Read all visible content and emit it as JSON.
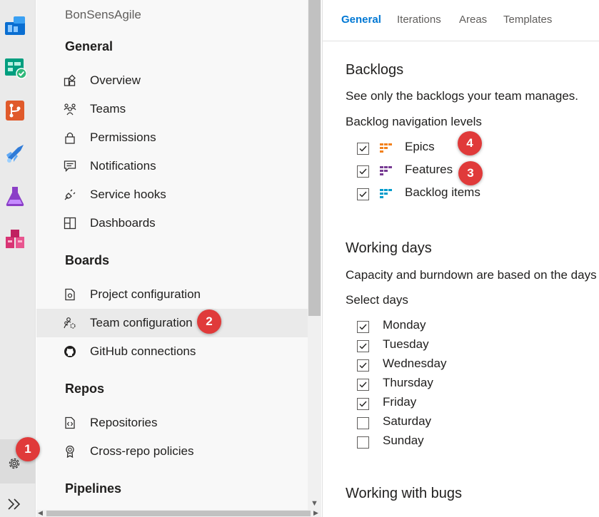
{
  "rail": {
    "icons": [
      "boards-overview-icon",
      "boards-icon",
      "repos-icon",
      "pipelines-icon",
      "test-plans-icon",
      "artifacts-icon"
    ],
    "settings_icon": "gear-icon",
    "expand_icon": "double-chevron-right-icon"
  },
  "nav": {
    "project_name": "BonSensAgile",
    "sections": {
      "general": "General",
      "boards": "Boards",
      "repos": "Repos",
      "pipelines": "Pipelines"
    },
    "items": {
      "overview": "Overview",
      "teams": "Teams",
      "permissions": "Permissions",
      "notifications": "Notifications",
      "service_hooks": "Service hooks",
      "dashboards": "Dashboards",
      "project_configuration": "Project configuration",
      "team_configuration": "Team configuration",
      "github_connections": "GitHub connections",
      "repositories": "Repositories",
      "cross_repo_policies": "Cross-repo policies"
    },
    "selected": "team_configuration"
  },
  "tabs": {
    "general": "General",
    "iterations": "Iterations",
    "areas": "Areas",
    "templates": "Templates",
    "active": "general"
  },
  "backlogs": {
    "title": "Backlogs",
    "description": "See only the backlogs your team manages.",
    "nav_levels_label": "Backlog navigation levels",
    "levels": [
      {
        "label": "Epics",
        "checked": true,
        "color": "#f2811d"
      },
      {
        "label": "Features",
        "checked": true,
        "color": "#773b93"
      },
      {
        "label": "Backlog items",
        "checked": true,
        "color": "#009ccc"
      }
    ]
  },
  "working_days": {
    "title": "Working days",
    "description": "Capacity and burndown are based on the days",
    "select_label": "Select days",
    "days": [
      {
        "label": "Monday",
        "checked": true
      },
      {
        "label": "Tuesday",
        "checked": true
      },
      {
        "label": "Wednesday",
        "checked": true
      },
      {
        "label": "Thursday",
        "checked": true
      },
      {
        "label": "Friday",
        "checked": true
      },
      {
        "label": "Saturday",
        "checked": false
      },
      {
        "label": "Sunday",
        "checked": false
      }
    ]
  },
  "working_with_bugs": {
    "title": "Working with bugs"
  },
  "annotations": {
    "b1": "1",
    "b2": "2",
    "b3": "3",
    "b4": "4"
  },
  "colors": {
    "accent": "#0078d4",
    "badge": "#e03a3a",
    "selected_nav": "#eaeaea"
  }
}
